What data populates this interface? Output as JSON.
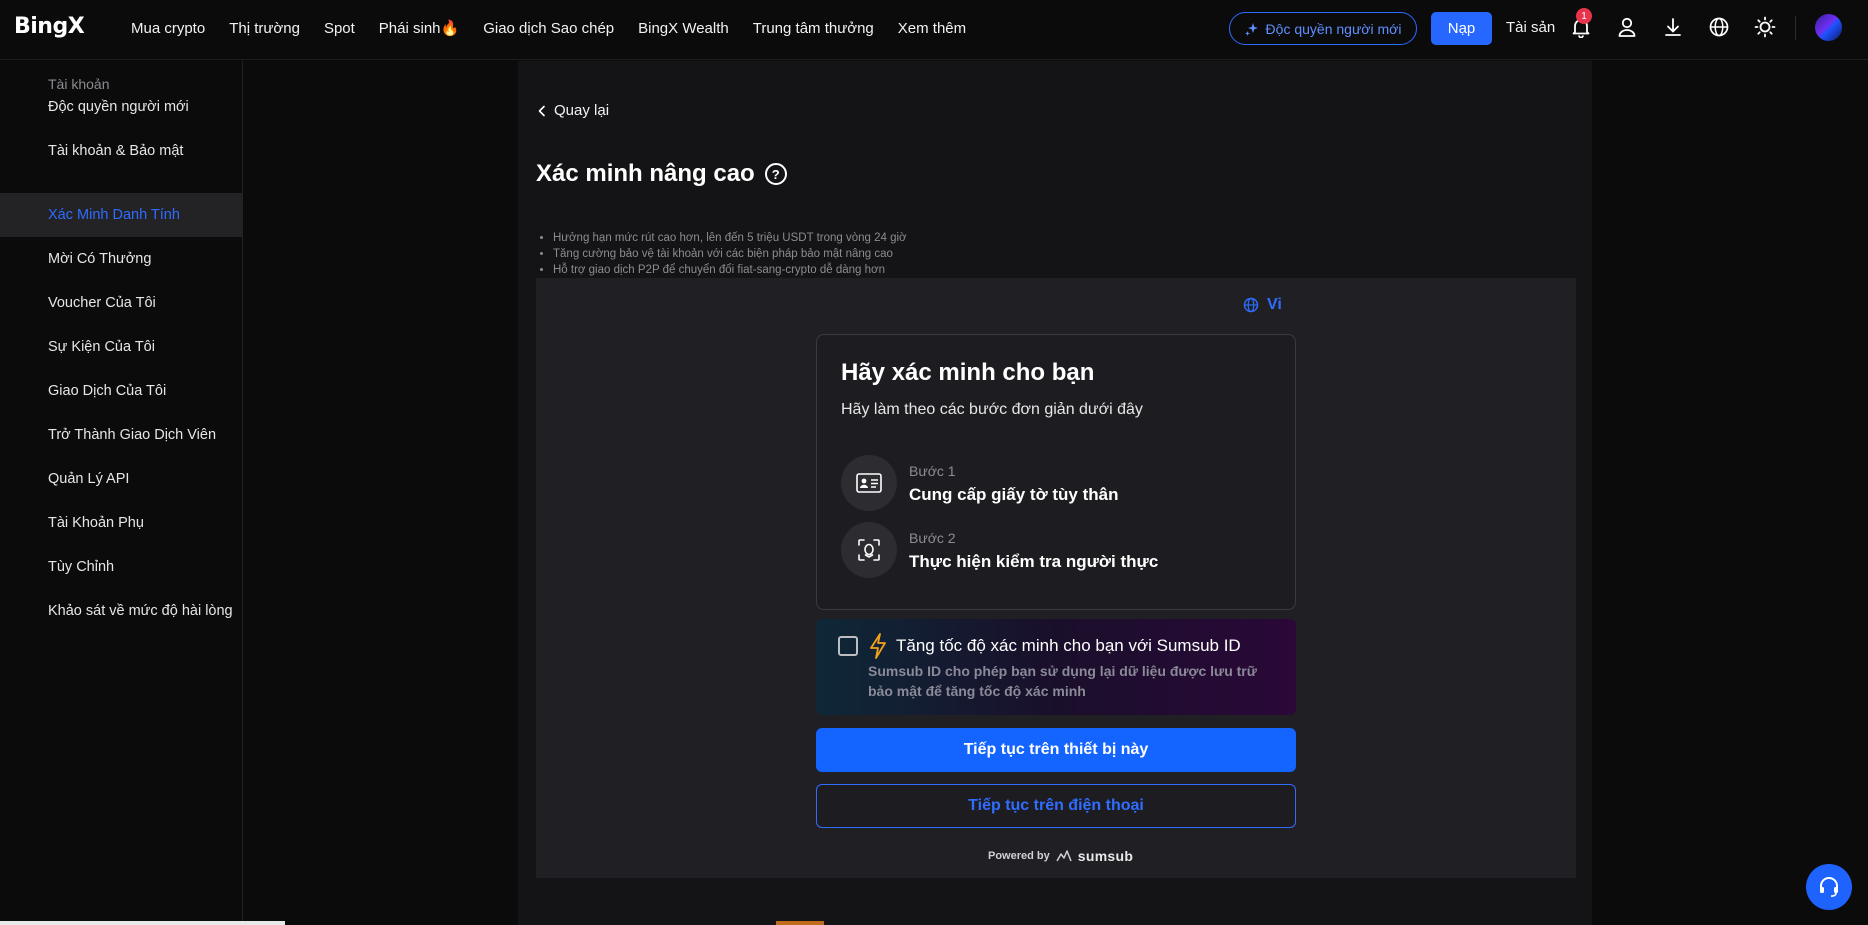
{
  "header": {
    "logo": "BingX",
    "nav": [
      "Mua crypto",
      "Thị trường",
      "Spot",
      "Phái sinh",
      "Giao dịch Sao chép",
      "BingX Wealth",
      "Trung tâm thưởng",
      "Xem thêm"
    ],
    "promo_label": "Độc quyền người mới",
    "deposit_label": "Nạp",
    "assets_label": "Tài sản",
    "notification_count": "1",
    "icons": [
      "bell-icon",
      "user-icon",
      "download-icon",
      "globe-icon",
      "sun-icon"
    ]
  },
  "sidebar": {
    "heading": "Tài khoản",
    "items": [
      {
        "label": "Độc quyền người mới"
      },
      {
        "label": "Tài khoản & Bảo mật"
      },
      {
        "label": "Xác Minh Danh Tính"
      },
      {
        "label": "Mời Có Thưởng"
      },
      {
        "label": "Voucher Của Tôi"
      },
      {
        "label": "Sự Kiện Của Tôi"
      },
      {
        "label": "Giao Dịch Của Tôi"
      },
      {
        "label": "Trở Thành Giao Dịch Viên"
      },
      {
        "label": "Quản Lý API"
      },
      {
        "label": "Tài Khoản Phụ"
      },
      {
        "label": "Tùy Chỉnh"
      },
      {
        "label": "Khảo sát về mức độ hài lòng"
      }
    ],
    "active": "Xác Minh Danh Tính"
  },
  "main": {
    "back_label": "Quay lại",
    "title": "Xác minh nâng cao",
    "benefits": [
      "Hưởng hạn mức rút cao hơn, lên đến 5 triệu USDT trong vòng 24 giờ",
      "Tăng cường bảo vệ tài khoản với các biện pháp bảo mật nâng cao",
      "Hỗ trợ giao dịch P2P để chuyển đổi fiat-sang-crypto dễ dàng hơn"
    ]
  },
  "verify": {
    "language": "Vi",
    "card_title": "Hãy xác minh cho bạn",
    "card_subtitle": "Hãy làm theo các bước đơn giản dưới đây",
    "steps": [
      {
        "num": "Bước 1",
        "text": "Cung cấp giấy tờ tùy thân"
      },
      {
        "num": "Bước 2",
        "text": "Thực hiện kiểm tra người thực"
      }
    ],
    "sumsub_title": "Tăng tốc độ xác minh cho bạn với Sumsub ID",
    "sumsub_desc": "Sumsub ID cho phép bạn sử dụng lại dữ liệu được lưu trữ bảo mật để tăng tốc độ xác minh",
    "sumsub_checked": false,
    "continue_device": "Tiếp tục trên thiết bị này",
    "continue_phone": "Tiếp tục trên điện thoại",
    "powered_by": "Powered by",
    "powered_brand": "sumsub"
  },
  "colors": {
    "accent": "#1465ff",
    "active_text": "#2f6cff",
    "badge": "#e8344a"
  }
}
